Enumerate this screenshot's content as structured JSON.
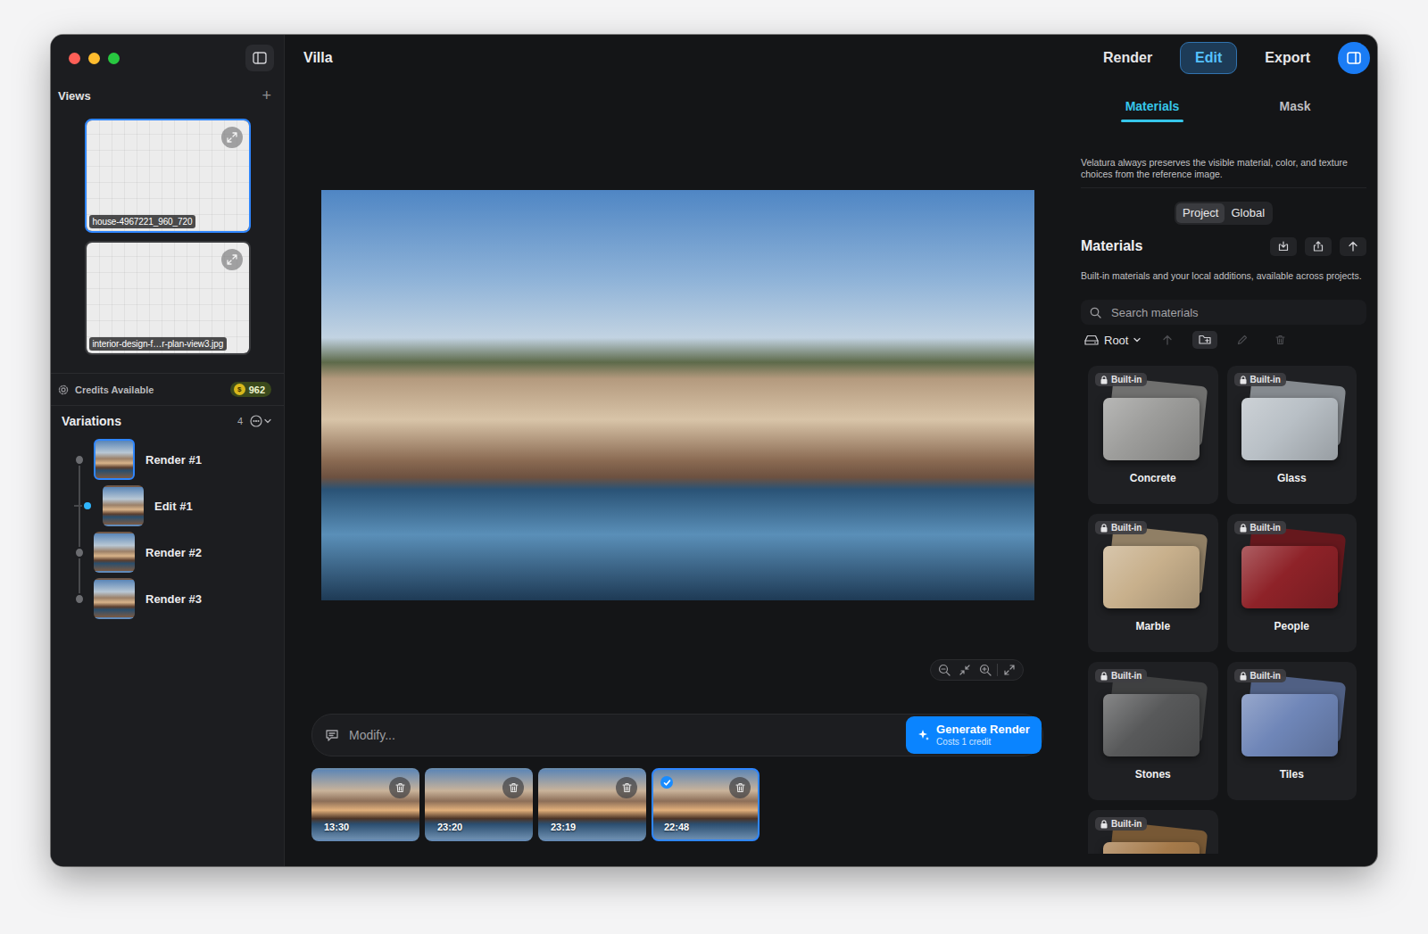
{
  "window": {
    "title": "Villa"
  },
  "nav": [
    {
      "label": "Render",
      "selected": false
    },
    {
      "label": "Edit",
      "selected": true
    },
    {
      "label": "Export",
      "selected": false
    }
  ],
  "views": {
    "title": "Views",
    "add": "+",
    "items": [
      {
        "label": "house-4967221_960_720",
        "selected": true
      },
      {
        "label": "interior-design-f…r-plan-view3.jpg",
        "selected": false
      }
    ]
  },
  "credits": {
    "label": "Credits Available",
    "icon": "$",
    "value": "962"
  },
  "variations": {
    "title": "Variations",
    "count": "4",
    "items": [
      {
        "label": "Render #1",
        "level": 0,
        "highlighted": true,
        "current": false
      },
      {
        "label": "Edit #1",
        "level": 1,
        "highlighted": false,
        "current": true
      },
      {
        "label": "Render #2",
        "level": 0,
        "highlighted": false,
        "current": false
      },
      {
        "label": "Render #3",
        "level": 0,
        "highlighted": false,
        "current": false
      }
    ]
  },
  "prompt": {
    "placeholder": "Modify...",
    "button": "Generate Render",
    "cost": "Costs 1 credit"
  },
  "renders": [
    {
      "time": "13:30",
      "selected": false
    },
    {
      "time": "23:20",
      "selected": false
    },
    {
      "time": "23:19",
      "selected": false
    },
    {
      "time": "22:48",
      "selected": true
    }
  ],
  "panel": {
    "tabs": [
      {
        "label": "Materials",
        "selected": true
      },
      {
        "label": "Mask",
        "selected": false
      }
    ],
    "note": "Velatura always preserves the visible material, color, and texture choices from the reference image.",
    "scope": [
      {
        "label": "Project",
        "selected": true
      },
      {
        "label": "Global",
        "selected": false
      }
    ],
    "title": "Materials",
    "subtitle": "Built-in materials and your local additions, available across projects.",
    "search": {
      "placeholder": "Search materials"
    },
    "folder": {
      "label": "Root"
    },
    "tools": [
      {
        "disabled": true
      },
      {
        "disabled": false
      },
      {
        "disabled": true
      },
      {
        "disabled": true
      }
    ],
    "materials": [
      {
        "badge": "Built-in",
        "name": "Concrete",
        "color": "#9c9c9a"
      },
      {
        "badge": "Built-in",
        "name": "Glass",
        "color": "#b9c0c6"
      },
      {
        "badge": "Built-in",
        "name": "Marble",
        "color": "#c8b08c"
      },
      {
        "badge": "Built-in",
        "name": "People",
        "color": "#8e2228"
      },
      {
        "badge": "Built-in",
        "name": "Stones",
        "color": "#58595a"
      },
      {
        "badge": "Built-in",
        "name": "Tiles",
        "color": "#6f86b8"
      },
      {
        "badge": "Built-in",
        "color": "#a57a4a"
      }
    ]
  }
}
